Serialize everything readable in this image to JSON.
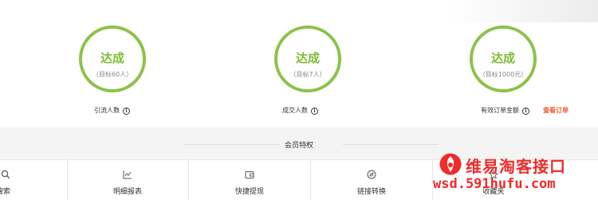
{
  "metrics": [
    {
      "status": "达成",
      "target": "（目标60人）",
      "label": "引流人数"
    },
    {
      "status": "达成",
      "target": "（目标7人）",
      "label": "成交人数"
    },
    {
      "status": "达成",
      "target": "（目标1000元）",
      "label": "有效订单金额"
    }
  ],
  "view_orders_link": "查看订单",
  "info_icon_glyph": "i",
  "privileges": {
    "title": "会员特权",
    "items": [
      {
        "label": "搜索",
        "icon": "search-icon"
      },
      {
        "label": "明细报表",
        "icon": "chart-icon"
      },
      {
        "label": "快捷提现",
        "icon": "wallet-icon"
      },
      {
        "label": "链接转换",
        "icon": "convert-icon"
      },
      {
        "label": "收藏夹",
        "icon": "favorites-icon"
      }
    ]
  },
  "watermark": {
    "title": "维易淘客接口",
    "url": "wsd.591hufu.com"
  },
  "colors": {
    "ring": "#8bc34a",
    "status_text": "#7cbd34",
    "link": "#f05a28",
    "watermark": "#ef2b2b"
  }
}
